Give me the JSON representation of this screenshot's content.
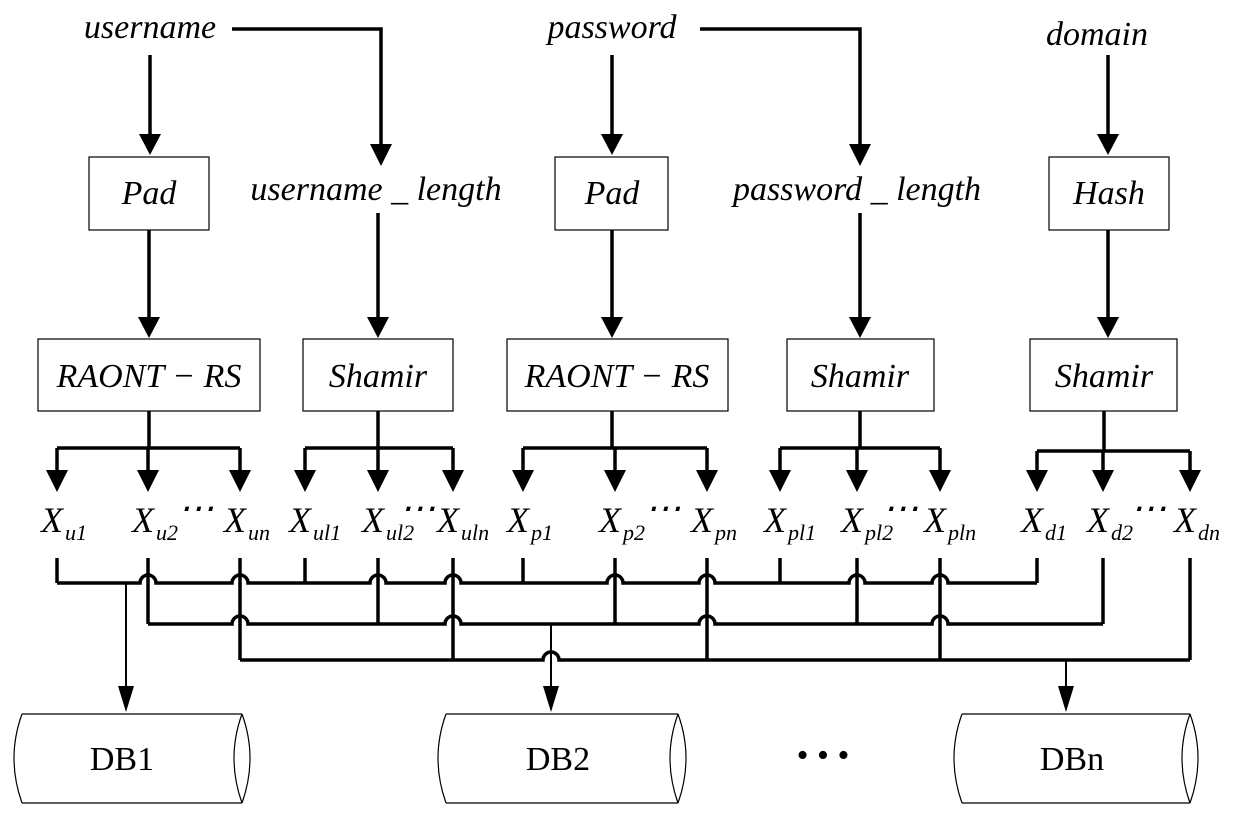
{
  "diagram": {
    "inputs": [
      {
        "id": "username",
        "label": "username"
      },
      {
        "id": "password",
        "label": "password"
      },
      {
        "id": "domain",
        "label": "domain"
      }
    ],
    "derived": [
      {
        "id": "username_length",
        "label": "username _ length"
      },
      {
        "id": "password_length",
        "label": "password _ length"
      }
    ],
    "stage1_boxes": [
      {
        "id": "pad-username",
        "label": "Pad"
      },
      {
        "id": "pad-password",
        "label": "Pad"
      },
      {
        "id": "hash-domain",
        "label": "Hash"
      }
    ],
    "stage2_boxes": [
      {
        "id": "raont-username",
        "label": "RAONT − RS"
      },
      {
        "id": "shamir-username-length",
        "label": "Shamir"
      },
      {
        "id": "raont-password",
        "label": "RAONT − RS"
      },
      {
        "id": "shamir-password-length",
        "label": "Shamir"
      },
      {
        "id": "shamir-domain",
        "label": "Shamir"
      }
    ],
    "shares": [
      {
        "base": "X",
        "sub": "u1"
      },
      {
        "base": "X",
        "sub": "u2"
      },
      {
        "base": "X",
        "sub": "un"
      },
      {
        "base": "X",
        "sub": "ul1"
      },
      {
        "base": "X",
        "sub": "ul2"
      },
      {
        "base": "X",
        "sub": "uln"
      },
      {
        "base": "X",
        "sub": "p1"
      },
      {
        "base": "X",
        "sub": "p2"
      },
      {
        "base": "X",
        "sub": "pn"
      },
      {
        "base": "X",
        "sub": "pl1"
      },
      {
        "base": "X",
        "sub": "pl2"
      },
      {
        "base": "X",
        "sub": "pln"
      },
      {
        "base": "X",
        "sub": "d1"
      },
      {
        "base": "X",
        "sub": "d2"
      },
      {
        "base": "X",
        "sub": "dn"
      }
    ],
    "ellipsis": "⋯",
    "databases": [
      {
        "id": "db1",
        "label": "DB1"
      },
      {
        "id": "db2",
        "label": "DB2"
      },
      {
        "id": "dbn",
        "label": "DBn"
      }
    ],
    "db_ellipsis": "• • •"
  }
}
